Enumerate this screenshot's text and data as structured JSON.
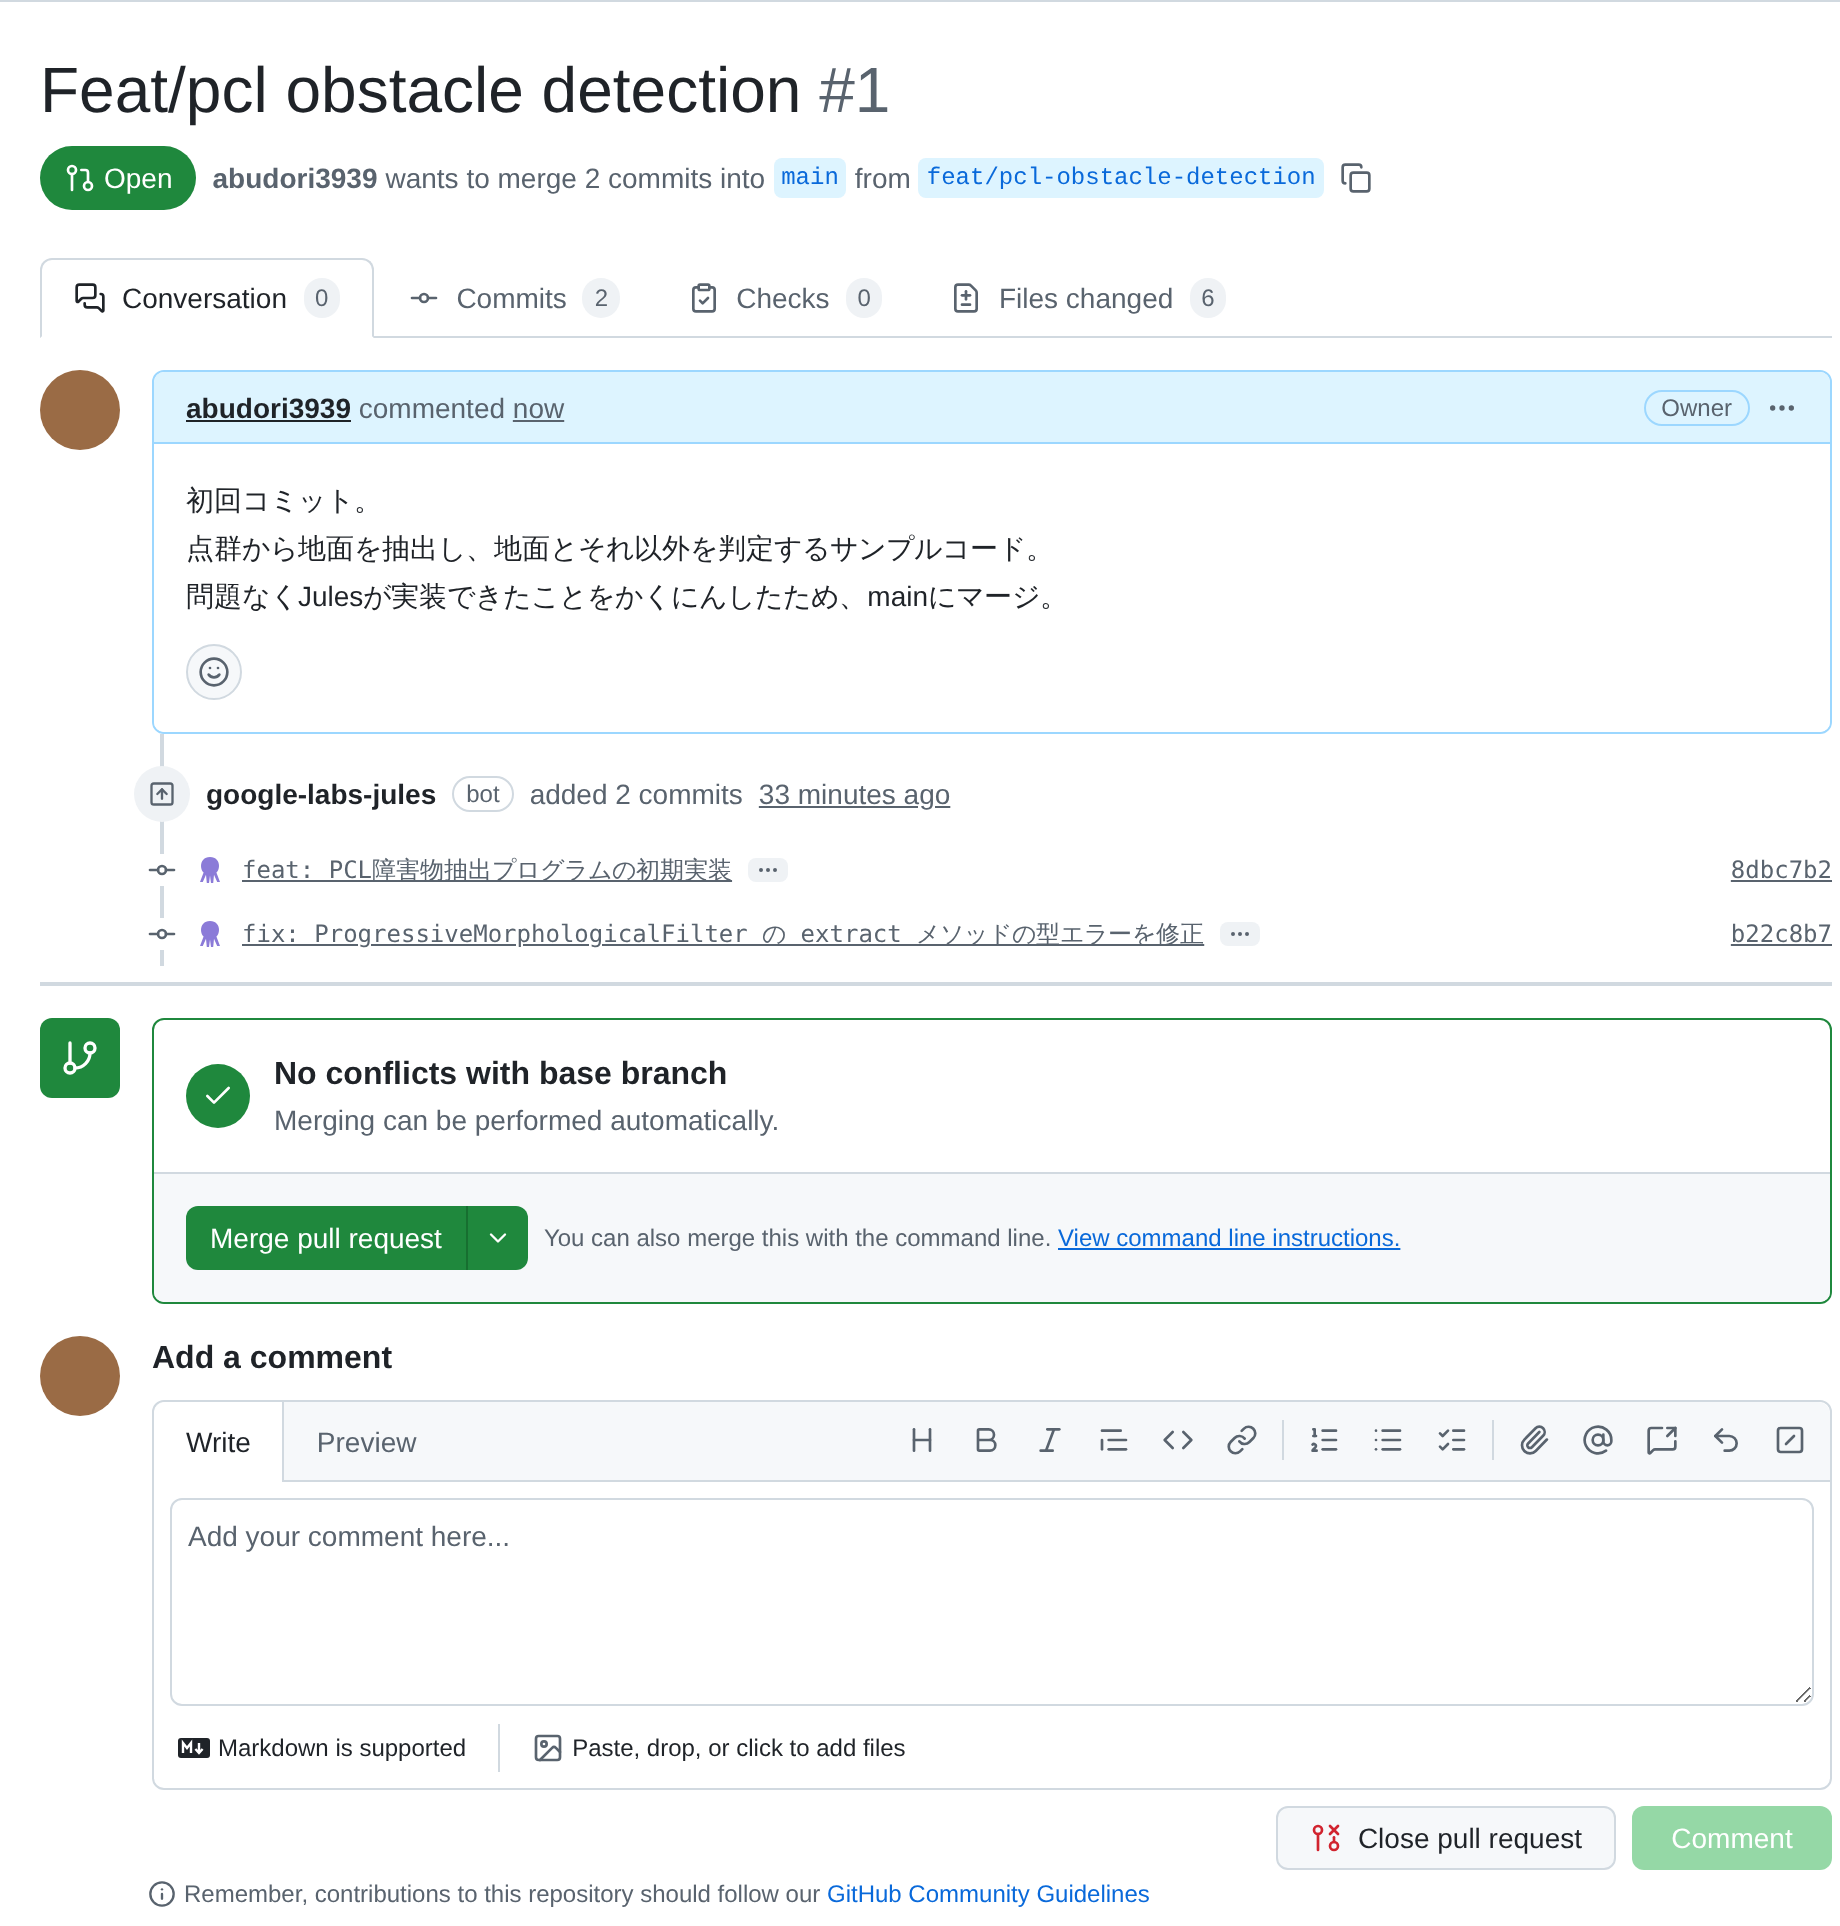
{
  "title": "Feat/pcl obstacle detection",
  "number": "#1",
  "status": {
    "label": "Open",
    "kind": "open"
  },
  "meta": {
    "author": "abudori3939",
    "text": "wants to merge 2 commits into",
    "base": "main",
    "text2": "from",
    "head": "feat/pcl-obstacle-detection"
  },
  "tabs": [
    {
      "label": "Conversation",
      "count": "0",
      "selected": true,
      "kind": "conversation"
    },
    {
      "label": "Commits",
      "count": "2",
      "selected": false,
      "kind": "commits"
    },
    {
      "label": "Checks",
      "count": "0",
      "selected": false,
      "kind": "checks"
    },
    {
      "label": "Files changed",
      "count": "6",
      "selected": false,
      "kind": "files"
    }
  ],
  "comment": {
    "author": "abudori3939",
    "action": "commented",
    "time": "now",
    "badge": "Owner",
    "lines": [
      "初回コミット。",
      "点群から地面を抽出し、地面とそれ以外を判定するサンプルコード。",
      "問題なくJulesが実装できたことをかくにんしたため、mainにマージ。"
    ]
  },
  "commit_event": {
    "actor": "google-labs-jules",
    "badge": "bot",
    "action": "added 2 commits",
    "time": "33 minutes ago",
    "commits": [
      {
        "message": "feat: PCL障害物抽出プログラムの初期実装",
        "sha": "8dbc7b2"
      },
      {
        "message": "fix: ProgressiveMorphologicalFilter の extract メソッドの型エラーを修正",
        "sha": "b22c8b7"
      }
    ]
  },
  "merge_box": {
    "title": "No conflicts with base branch",
    "subtitle": "Merging can be performed automatically.",
    "button": "Merge pull request",
    "note": "You can also merge this with the command line.",
    "link": "View command line instructions."
  },
  "add_comment": {
    "heading": "Add a comment",
    "tabs": [
      {
        "label": "Write",
        "selected": true
      },
      {
        "label": "Preview",
        "selected": false
      }
    ],
    "placeholder": "Add your comment here...",
    "markdown_note": "Markdown is supported",
    "attach_note": "Paste, drop, or click to add files",
    "close_button": "Close pull request",
    "comment_button": {
      "label": "Comment",
      "disabled": true
    }
  },
  "footer": {
    "text": "Remember, contributions to this repository should follow our",
    "link": "GitHub Community Guidelines"
  }
}
